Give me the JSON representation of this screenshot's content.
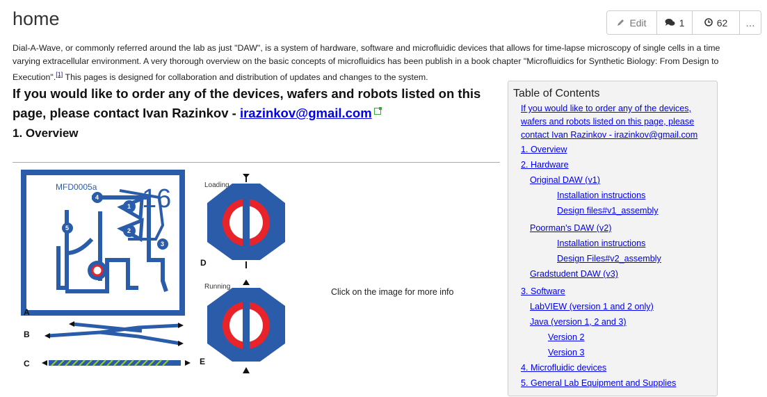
{
  "page": {
    "title": "home"
  },
  "toolbar": {
    "edit_label": "Edit",
    "comments_count": "1",
    "history_count": "62",
    "more_label": "…"
  },
  "intro": {
    "text_before": "Dial-A-Wave, or commonly referred around the lab as just \"DAW\", is a system of hardware, software and microfluidic devices that allows for time-lapse microscopy of single cells in a time varying extracellular environment. A very thorough overview on the basic concepts of microfluidics has been publish in a book chapter \"Microfluidics for Synthetic Biology: From Design to Execution\".",
    "footnote": "[1]",
    "text_after": " This pages is designed for collaboration and distribution of updates and changes to the system."
  },
  "order_heading": {
    "text": "If you would like to order any of the devices, wafers and robots listed on this page, please contact Ivan Razinkov - ",
    "email": "irazinkov@gmail.com"
  },
  "overview_heading": "1. Overview",
  "figure": {
    "chip_label": "MFD0005a",
    "chip_number": "16",
    "loading_label": "Loading",
    "running_label": "Running",
    "letters": [
      "A",
      "B",
      "C",
      "D",
      "E"
    ],
    "node_labels": [
      "1",
      "2",
      "3",
      "4",
      "5"
    ]
  },
  "caption": "Click on the image for more info",
  "toc": {
    "title": "Table of Contents",
    "items": [
      "If you would like to order any of the devices, wafers and robots listed on this page, please contact Ivan Razinkov - irazinkov@gmail.com",
      "1. Overview",
      "2. Hardware",
      "Original DAW (v1)",
      "Installation instructions",
      "Design files#v1_assembly",
      "Poorman's DAW (v2)",
      "Installation instructions",
      "Design Files#v2_assembly",
      "Gradstudent DAW (v3)",
      "3. Software",
      "LabVIEW (version 1 and 2 only)",
      "Java (version 1, 2 and 3)",
      "Version 2",
      "Version 3",
      "4. Microfluidic devices",
      "5. General Lab Equipment and Supplies"
    ]
  },
  "colors": {
    "link": "#0000ee",
    "device_blue": "#2a5caa",
    "device_red": "#e8232a",
    "toc_bg": "#f3f3f3"
  }
}
